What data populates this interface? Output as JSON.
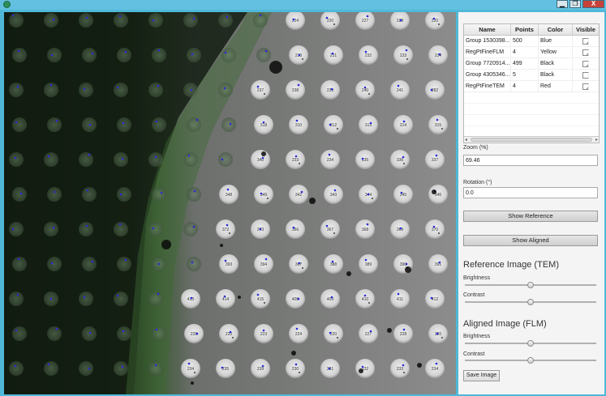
{
  "window": {
    "min_glyph": "▁",
    "max_glyph": "❐",
    "close_glyph": "X"
  },
  "table": {
    "headers": [
      "Name",
      "Points",
      "Color",
      "Visible"
    ],
    "rows": [
      {
        "name": "Group 1530398...",
        "points": "500",
        "color": "Blue",
        "visible": true
      },
      {
        "name": "RegPtFineFLM",
        "points": "4",
        "color": "Yellow",
        "visible": true
      },
      {
        "name": "Group 7720914...",
        "points": "499",
        "color": "Black",
        "visible": true
      },
      {
        "name": "Group 4305346...",
        "points": "5",
        "color": "Black",
        "visible": false
      },
      {
        "name": "RegPtFineTEM",
        "points": "4",
        "color": "Red",
        "visible": true
      }
    ]
  },
  "zoom": {
    "label": "Zoom (%)",
    "value": "69.46"
  },
  "rotation": {
    "label": "Rotation (°)",
    "value": "0.0"
  },
  "buttons": {
    "show_reference": "Show Reference",
    "show_aligned": "Show Aligned",
    "save_image": "Save Image"
  },
  "reference": {
    "title": "Reference Image (TEM)",
    "brightness_label": "Brightness",
    "contrast_label": "Contrast",
    "brightness_level": 0.5,
    "contrast_level": 0.5
  },
  "aligned": {
    "title": "Aligned Image (FLM)",
    "brightness_label": "Brightness",
    "contrast_label": "Contrast",
    "brightness_level": 0.5,
    "contrast_level": 0.5
  },
  "colors": {
    "panel_bg": "#f4f4f4",
    "window_frame": "#4fb8d8",
    "hole_fill": "#dcdcdc",
    "blue_marker": "#2a2ad8",
    "black_marker": "#111111",
    "close_button": "#c8423a"
  },
  "image_labels": {
    "row1": [
      "220",
      "223",
      "224",
      "220",
      "227",
      "228"
    ],
    "row2": [
      "239",
      "230",
      "231",
      "232",
      "233",
      "234",
      "235"
    ],
    "row3": [
      "237",
      "238",
      "239",
      "240",
      "241",
      "282",
      "283"
    ],
    "row4": [
      "310",
      "312",
      "313",
      "314",
      "315",
      "316",
      "317",
      "318"
    ],
    "row5": [
      "233",
      "234",
      "335",
      "336",
      "337",
      "338",
      "339",
      "340"
    ],
    "row6": [
      "342",
      "343",
      "344",
      "345",
      "346",
      "347",
      "348",
      "349"
    ],
    "row7": [
      "366",
      "367",
      "368",
      "369",
      "370",
      "371",
      "372",
      "373"
    ],
    "row8": [
      "387",
      "388",
      "389",
      "390",
      "391",
      "392",
      "393",
      "394"
    ],
    "row9": [
      "408",
      "409",
      "410",
      "411",
      "412",
      "413",
      "414",
      "415"
    ]
  }
}
